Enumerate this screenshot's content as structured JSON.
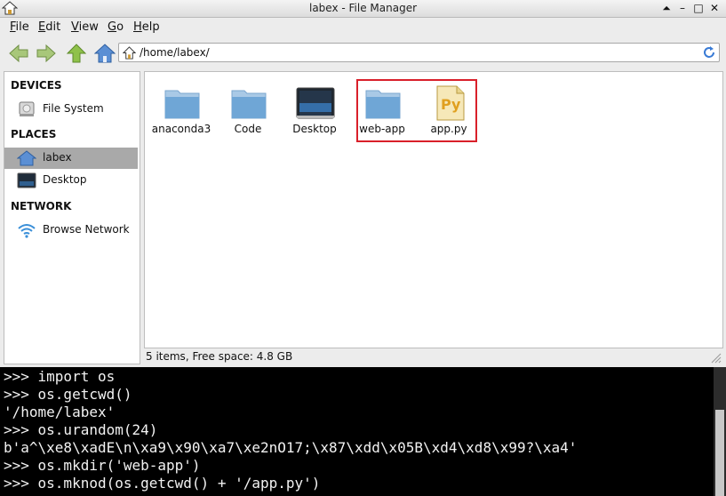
{
  "window": {
    "title": "labex - File Manager",
    "controls": [
      "⏶",
      "–",
      "□",
      "✕"
    ]
  },
  "menu": [
    {
      "label": "File"
    },
    {
      "label": "Edit"
    },
    {
      "label": "View"
    },
    {
      "label": "Go"
    },
    {
      "label": "Help"
    }
  ],
  "address": {
    "path": "/home/labex/"
  },
  "sidebar": {
    "devices_heading": "DEVICES",
    "places_heading": "PLACES",
    "network_heading": "NETWORK",
    "items": [
      {
        "label": "File System",
        "icon": "drive-icon"
      },
      {
        "label": "labex",
        "icon": "home-folder-icon",
        "selected": true
      },
      {
        "label": "Desktop",
        "icon": "desktop-icon"
      },
      {
        "label": "Browse Network",
        "icon": "wifi-icon"
      }
    ]
  },
  "files": [
    {
      "name": "anaconda3",
      "icon": "folder-icon"
    },
    {
      "name": "Code",
      "icon": "folder-icon"
    },
    {
      "name": "Desktop",
      "icon": "desktop-folder-icon"
    },
    {
      "name": "web-app",
      "icon": "folder-icon"
    },
    {
      "name": "app.py",
      "icon": "python-file-icon"
    }
  ],
  "status": "5 items, Free space: 4.8 GB",
  "terminal": {
    "lines": [
      ">>> import os",
      ">>> os.getcwd()",
      "'/home/labex'",
      ">>> os.urandom(24)",
      "b'a^\\xe8\\xadE\\n\\xa9\\x90\\xa7\\xe2nO17;\\x87\\xdd\\x05B\\xd4\\xd8\\x99?\\xa4'",
      ">>> os.mkdir('web-app')",
      ">>> os.mknod(os.getcwd() + '/app.py')"
    ]
  },
  "colors": {
    "highlight": "#d9202a",
    "selected_bg": "#a9a9a9",
    "folder": "#6fa6d6"
  }
}
